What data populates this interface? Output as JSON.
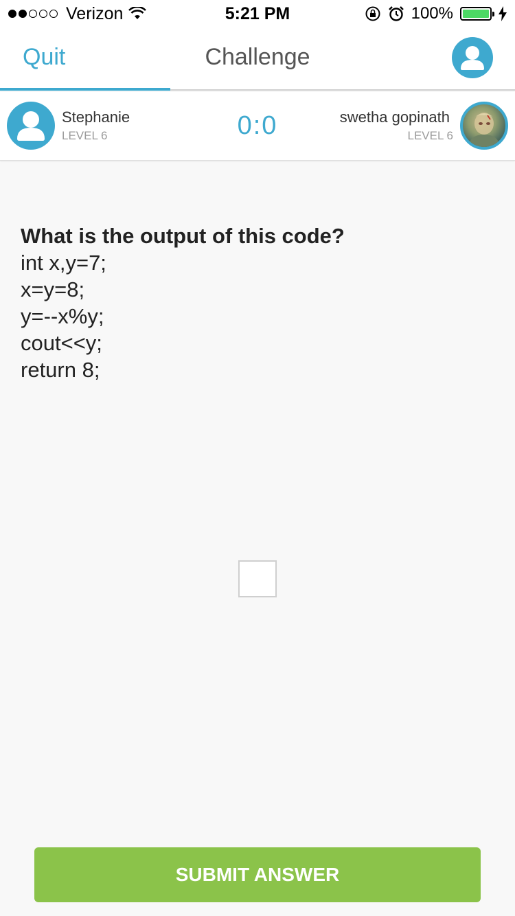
{
  "status_bar": {
    "carrier": "Verizon",
    "time": "5:21 PM",
    "battery": "100%",
    "signal_bars": 2,
    "icons": [
      "wifi-icon",
      "orientation-lock-icon",
      "alarm-icon",
      "battery-icon",
      "charging-icon"
    ]
  },
  "nav": {
    "quit_label": "Quit",
    "title": "Challenge",
    "progress": 0.33
  },
  "players": {
    "left": {
      "name": "Stephanie",
      "level": "LEVEL 6"
    },
    "score": "0:0",
    "right": {
      "name": "swetha gopinath",
      "level": "LEVEL 6"
    }
  },
  "question": {
    "lines": [
      "What is the output of this code?",
      "int x,y=7;",
      "x=y=8;",
      "y=--x%y;",
      "cout<<y;",
      "return 8;"
    ]
  },
  "answer": {
    "value": ""
  },
  "submit_label": "SUBMIT ANSWER",
  "colors": {
    "accent": "#3ea9cf",
    "submit": "#8bc34a",
    "battery": "#4cd964"
  }
}
